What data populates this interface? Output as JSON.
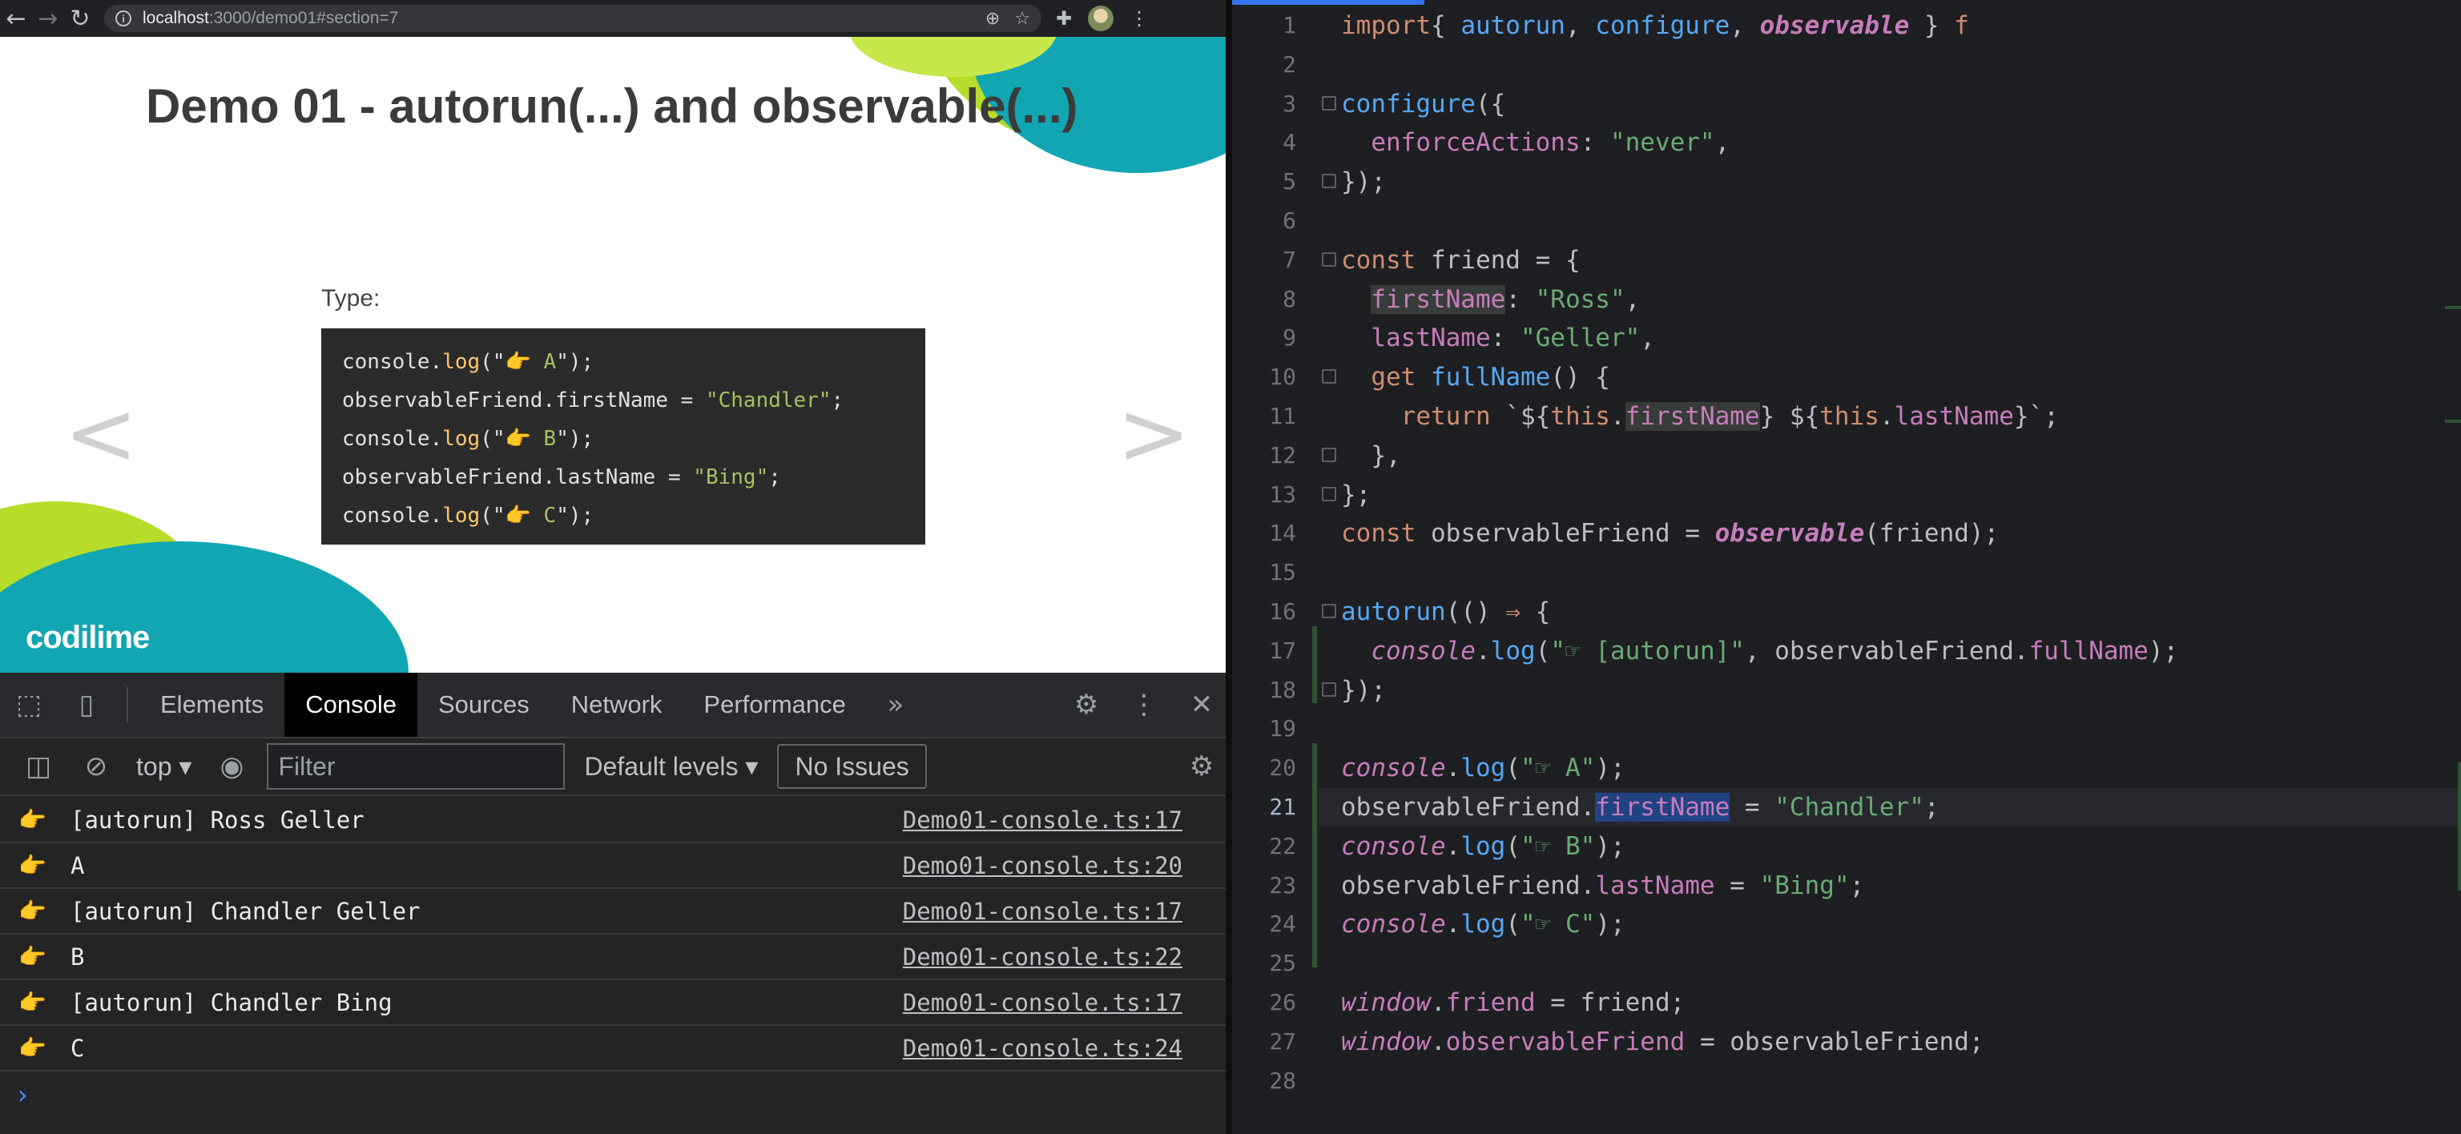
{
  "browser": {
    "url_host": "localhost",
    "url_path": ":3000/demo01#section=7",
    "nav": {
      "back": "←",
      "forward": "→",
      "reload": "↻"
    }
  },
  "slide": {
    "title": "Demo 01 - autorun(...) and observable(...)",
    "type_label": "Type:",
    "code": [
      {
        "pre": "console.",
        "fn": "log",
        "open": "(\"",
        "hand": "👉",
        "str": " A",
        "close": "\");"
      },
      {
        "plain": "observableFriend.firstName = ",
        "str2": "\"Chandler\"",
        "tail": ";"
      },
      {
        "pre": "console.",
        "fn": "log",
        "open": "(\"",
        "hand": "👉",
        "str": " B",
        "close": "\");"
      },
      {
        "plain": "observableFriend.lastName = ",
        "str2": "\"Bing\"",
        "tail": ";"
      },
      {
        "pre": "console.",
        "fn": "log",
        "open": "(\"",
        "hand": "👉",
        "str": " C",
        "close": "\");"
      }
    ],
    "prev_arrow": "<",
    "next_arrow": ">",
    "logo": "codilime"
  },
  "devtools": {
    "tabs": [
      "Elements",
      "Console",
      "Sources",
      "Network",
      "Performance"
    ],
    "active_tab": "Console",
    "more_tabs": "»",
    "close": "✕",
    "context": "top",
    "filter_placeholder": "Filter",
    "levels": "Default levels",
    "issues": "No Issues",
    "rows": [
      {
        "msg": "[autorun] Ross Geller",
        "src": "Demo01-console.ts:17"
      },
      {
        "msg": "A",
        "src": "Demo01-console.ts:20"
      },
      {
        "msg": "[autorun] Chandler Geller",
        "src": "Demo01-console.ts:17"
      },
      {
        "msg": "B",
        "src": "Demo01-console.ts:22"
      },
      {
        "msg": "[autorun] Chandler Bing",
        "src": "Demo01-console.ts:17"
      },
      {
        "msg": "C",
        "src": "Demo01-console.ts:24"
      }
    ],
    "prompt": "›"
  },
  "editor": {
    "current_line": 21,
    "line_numbers": [
      "1",
      "2",
      "3",
      "4",
      "5",
      "6",
      "7",
      "8",
      "9",
      "10",
      "11",
      "12",
      "13",
      "14",
      "15",
      "16",
      "17",
      "18",
      "19",
      "20",
      "21",
      "22",
      "23",
      "24",
      "25",
      "26",
      "27",
      "28"
    ],
    "lines": [
      [
        [
          "kw",
          "import"
        ],
        [
          "",
          "{ "
        ],
        [
          "fn",
          "autorun"
        ],
        [
          "",
          ", "
        ],
        [
          "fn",
          "configure"
        ],
        [
          "",
          ", "
        ],
        [
          "it",
          "observable"
        ],
        [
          "",
          " } "
        ],
        [
          "kw",
          "f"
        ]
      ],
      [],
      [
        [
          "fn",
          "configure"
        ],
        [
          "",
          "({"
        ]
      ],
      [
        [
          "",
          "  "
        ],
        [
          "pr",
          "enforceActions"
        ],
        [
          "",
          ": "
        ],
        [
          "str",
          "\"never\""
        ],
        [
          "",
          ","
        ]
      ],
      [
        [
          "",
          "});"
        ]
      ],
      [],
      [
        [
          "kw",
          "const"
        ],
        [
          "",
          " friend = {"
        ]
      ],
      [
        [
          "",
          "  "
        ],
        [
          "pru",
          "firstName"
        ],
        [
          "",
          ": "
        ],
        [
          "str",
          "\"Ross\""
        ],
        [
          "",
          ","
        ]
      ],
      [
        [
          "",
          "  "
        ],
        [
          "pr",
          "lastName"
        ],
        [
          "",
          ": "
        ],
        [
          "str",
          "\"Geller\""
        ],
        [
          "",
          ","
        ]
      ],
      [
        [
          "",
          "  "
        ],
        [
          "kw",
          "get"
        ],
        [
          "",
          " "
        ],
        [
          "fn",
          "fullName"
        ],
        [
          "",
          "() {"
        ]
      ],
      [
        [
          "",
          "    "
        ],
        [
          "kw",
          "return"
        ],
        [
          "",
          " `${"
        ],
        [
          "kw",
          "this"
        ],
        [
          "",
          "."
        ],
        [
          "pru",
          "firstName"
        ],
        [
          "",
          "} ${"
        ],
        [
          "kw",
          "this"
        ],
        [
          "",
          "."
        ],
        [
          "pr",
          "lastName"
        ],
        [
          "",
          "}`;"
        ]
      ],
      [
        [
          "",
          "  },"
        ]
      ],
      [
        [
          "",
          "};"
        ]
      ],
      [
        [
          "kw",
          "const"
        ],
        [
          "",
          " observableFriend = "
        ],
        [
          "it",
          "observable"
        ],
        [
          "",
          "(friend);"
        ]
      ],
      [],
      [
        [
          "fn",
          "autorun"
        ],
        [
          "",
          "(() "
        ],
        [
          "kw",
          "⇒"
        ],
        [
          "",
          " {"
        ]
      ],
      [
        [
          "",
          "  "
        ],
        [
          "gl",
          "console"
        ],
        [
          "",
          "."
        ],
        [
          "fn",
          "log"
        ],
        [
          "",
          "("
        ],
        [
          "str",
          "\"☞ [autorun]\""
        ],
        [
          "",
          ", observableFriend."
        ],
        [
          "pr",
          "fullName"
        ],
        [
          "",
          ");"
        ]
      ],
      [
        [
          "",
          "});"
        ]
      ],
      [],
      [
        [
          "gl",
          "console"
        ],
        [
          "",
          "."
        ],
        [
          "fn",
          "log"
        ],
        [
          "",
          "("
        ],
        [
          "str",
          "\"☞ A\""
        ],
        [
          "",
          ");"
        ]
      ],
      [
        [
          "",
          "observableFriend."
        ],
        [
          "prs",
          "firstName"
        ],
        [
          "",
          " = "
        ],
        [
          "str",
          "\"Chandler\""
        ],
        [
          "",
          ";"
        ]
      ],
      [
        [
          "gl",
          "console"
        ],
        [
          "",
          "."
        ],
        [
          "fn",
          "log"
        ],
        [
          "",
          "("
        ],
        [
          "str",
          "\"☞ B\""
        ],
        [
          "",
          ");"
        ]
      ],
      [
        [
          "",
          "observableFriend."
        ],
        [
          "pr",
          "lastName"
        ],
        [
          "",
          " = "
        ],
        [
          "str",
          "\"Bing\""
        ],
        [
          "",
          ";"
        ]
      ],
      [
        [
          "gl",
          "console"
        ],
        [
          "",
          "."
        ],
        [
          "fn",
          "log"
        ],
        [
          "",
          "("
        ],
        [
          "str",
          "\"☞ C\""
        ],
        [
          "",
          ");"
        ]
      ],
      [],
      [
        [
          "gl",
          "window"
        ],
        [
          "",
          "."
        ],
        [
          "pr",
          "friend"
        ],
        [
          "",
          " = friend;"
        ]
      ],
      [
        [
          "gl",
          "window"
        ],
        [
          "",
          "."
        ],
        [
          "pr",
          "observableFriend"
        ],
        [
          "",
          " = observableFriend;"
        ]
      ],
      []
    ]
  }
}
